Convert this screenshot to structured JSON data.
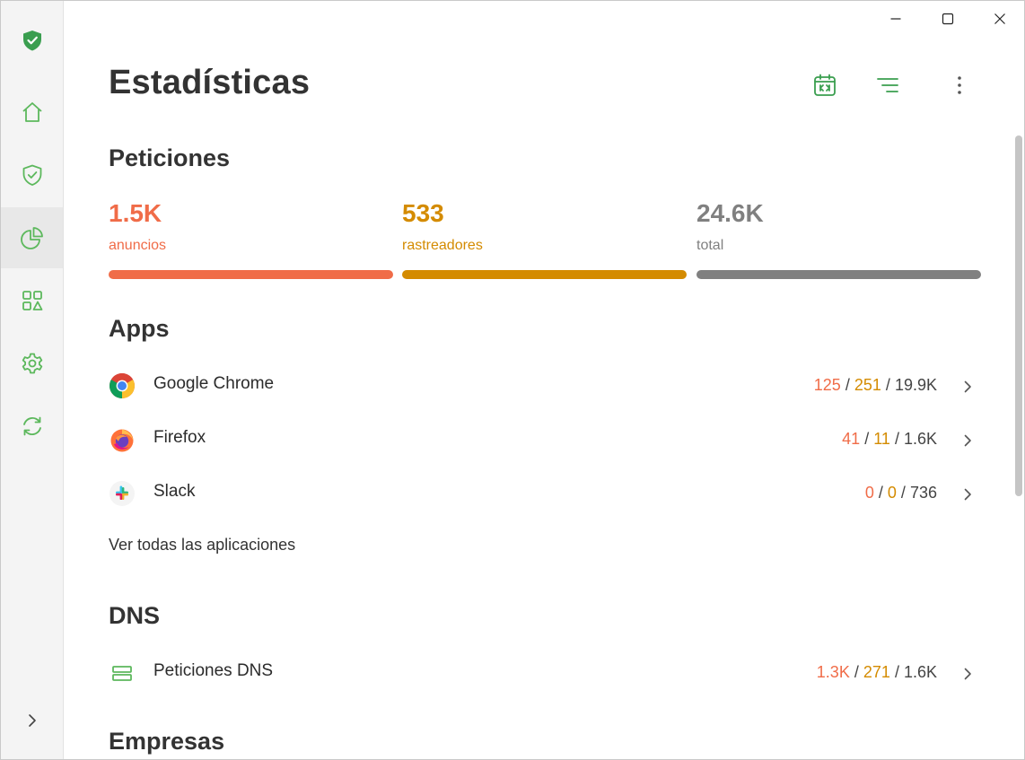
{
  "app": {
    "brand_icon": "shield-check-icon",
    "accent": "#5cb85c"
  },
  "sidebar": {
    "items": [
      {
        "id": "home",
        "icon": "home-icon"
      },
      {
        "id": "protection",
        "icon": "shield-icon"
      },
      {
        "id": "statistics",
        "icon": "pie-chart-icon",
        "active": true
      },
      {
        "id": "apps",
        "icon": "shapes-icon"
      },
      {
        "id": "settings",
        "icon": "gear-icon"
      },
      {
        "id": "update",
        "icon": "refresh-icon"
      }
    ],
    "expand_icon": "chevron-right-icon"
  },
  "page": {
    "title": "Estadísticas"
  },
  "requests": {
    "title": "Peticiones",
    "stats": [
      {
        "value": "1.5K",
        "label": "anuncios",
        "color": "#f06c48"
      },
      {
        "value": "533",
        "label": "rastreadores",
        "color": "#d48b00"
      },
      {
        "value": "24.6K",
        "label": "total",
        "color": "#808080"
      }
    ]
  },
  "apps": {
    "title": "Apps",
    "items": [
      {
        "name": "Google Chrome",
        "ads": "125",
        "trackers": "251",
        "total": "19.9K",
        "icon": "chrome-icon"
      },
      {
        "name": "Firefox",
        "ads": "41",
        "trackers": "11",
        "total": "1.6K",
        "icon": "firefox-icon"
      },
      {
        "name": "Slack",
        "ads": "0",
        "trackers": "0",
        "total": "736",
        "icon": "slack-icon"
      }
    ],
    "see_all": "Ver todas las aplicaciones"
  },
  "dns": {
    "title": "DNS",
    "item": {
      "name": "Peticiones DNS",
      "ads": "1.3K",
      "trackers": "271",
      "total": "1.6K",
      "icon": "server-icon"
    }
  },
  "companies": {
    "title": "Empresas"
  },
  "separator": "/"
}
